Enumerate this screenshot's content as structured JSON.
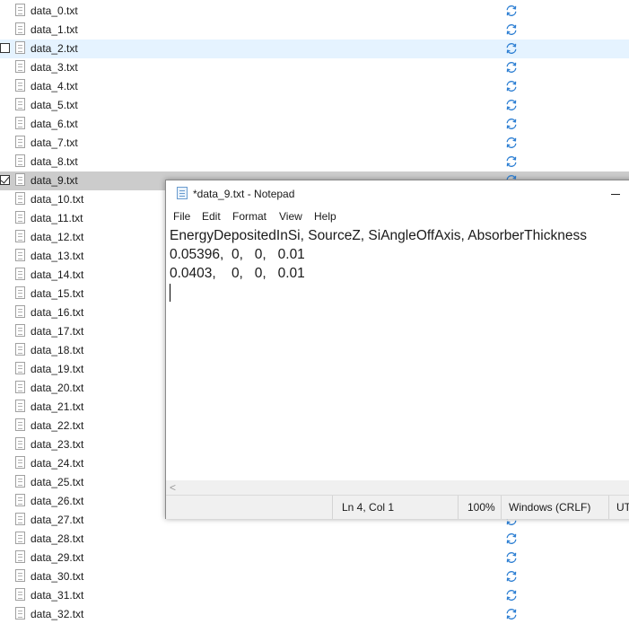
{
  "explorer": {
    "files": [
      {
        "name": "data_0.txt"
      },
      {
        "name": "data_1.txt"
      },
      {
        "name": "data_2.txt",
        "state": "hover"
      },
      {
        "name": "data_3.txt"
      },
      {
        "name": "data_4.txt"
      },
      {
        "name": "data_5.txt"
      },
      {
        "name": "data_6.txt"
      },
      {
        "name": "data_7.txt"
      },
      {
        "name": "data_8.txt"
      },
      {
        "name": "data_9.txt",
        "state": "selected"
      },
      {
        "name": "data_10.txt"
      },
      {
        "name": "data_11.txt"
      },
      {
        "name": "data_12.txt"
      },
      {
        "name": "data_13.txt"
      },
      {
        "name": "data_14.txt"
      },
      {
        "name": "data_15.txt"
      },
      {
        "name": "data_16.txt"
      },
      {
        "name": "data_17.txt"
      },
      {
        "name": "data_18.txt"
      },
      {
        "name": "data_19.txt"
      },
      {
        "name": "data_20.txt"
      },
      {
        "name": "data_21.txt"
      },
      {
        "name": "data_22.txt"
      },
      {
        "name": "data_23.txt"
      },
      {
        "name": "data_24.txt"
      },
      {
        "name": "data_25.txt"
      },
      {
        "name": "data_26.txt"
      },
      {
        "name": "data_27.txt"
      },
      {
        "name": "data_28.txt"
      },
      {
        "name": "data_29.txt"
      },
      {
        "name": "data_30.txt"
      },
      {
        "name": "data_31.txt"
      },
      {
        "name": "data_32.txt"
      }
    ],
    "file_icon": "text-file-icon",
    "status_icon": "sync-pending-icon",
    "status_icon_color": "#2d7fd3",
    "hover_color": "#e5f3ff",
    "selected_color": "#cccccc"
  },
  "notepad": {
    "title": "*data_9.txt - Notepad",
    "app_icon": "notepad-icon",
    "menu": [
      "File",
      "Edit",
      "Format",
      "View",
      "Help"
    ],
    "content_lines": [
      "EnergyDepositedInSi, SourceZ, SiAngleOffAxis, AbsorberThickness",
      "0.05396,  0,   0,   0.01",
      "0.0403,    0,   0,   0.01"
    ],
    "hscroll_arrow": "<",
    "status": {
      "position": "Ln 4, Col 1",
      "zoom": "100%",
      "line_endings": "Windows (CRLF)",
      "encoding": "UT"
    }
  }
}
